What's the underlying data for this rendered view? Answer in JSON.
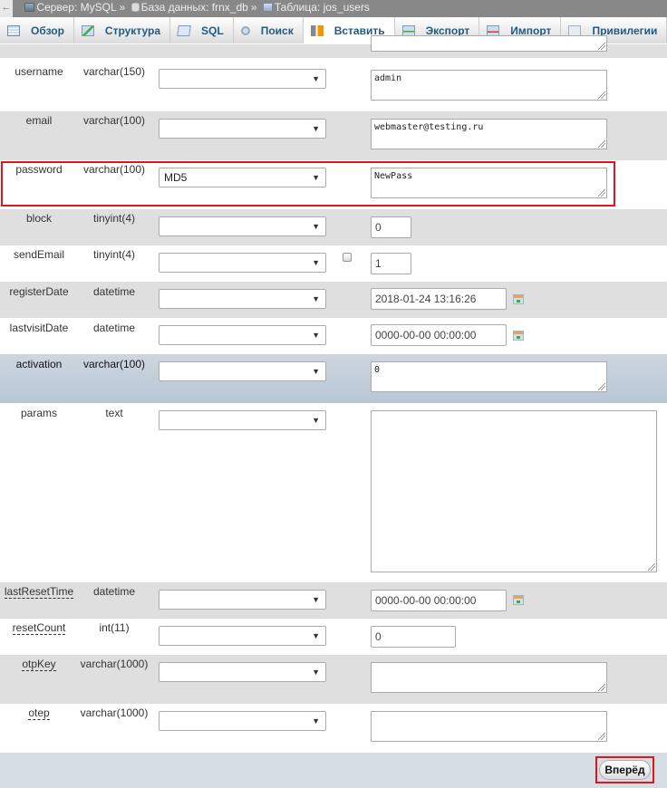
{
  "breadcrumb": {
    "back_icon": "arrow-left-icon",
    "items": [
      {
        "icon": "server-icon",
        "label": "Сервер: MySQL"
      },
      {
        "icon": "database-icon",
        "label": "База данных: frnx_db"
      },
      {
        "icon": "table-icon",
        "label": "Таблица: jos_users"
      }
    ],
    "separator": "»"
  },
  "tabs": [
    {
      "icon": "browse-icon",
      "label": "Обзор",
      "active": false
    },
    {
      "icon": "structure-icon",
      "label": "Структура",
      "active": false
    },
    {
      "icon": "sql-icon",
      "label": "SQL",
      "active": false
    },
    {
      "icon": "search-icon",
      "label": "Поиск",
      "active": false
    },
    {
      "icon": "insert-icon",
      "label": "Вставить",
      "active": true
    },
    {
      "icon": "export-icon",
      "label": "Экспорт",
      "active": false
    },
    {
      "icon": "import-icon",
      "label": "Импорт",
      "active": false
    },
    {
      "icon": "privileges-icon",
      "label": "Привилегии",
      "active": false
    }
  ],
  "fields": [
    {
      "name": "username",
      "type": "varchar(150)",
      "function": "",
      "value": "admin",
      "input": "textarea"
    },
    {
      "name": "email",
      "type": "varchar(100)",
      "function": "",
      "value": "webmaster@testing.ru",
      "input": "textarea"
    },
    {
      "name": "password",
      "type": "varchar(100)",
      "function": "MD5",
      "value": "NewPass",
      "input": "textarea",
      "highlighted": true
    },
    {
      "name": "block",
      "type": "tinyint(4)",
      "function": "",
      "value": "0",
      "input": "text"
    },
    {
      "name": "sendEmail",
      "type": "tinyint(4)",
      "function": "",
      "value": "1",
      "input": "text",
      "null_checkbox": false
    },
    {
      "name": "registerDate",
      "type": "datetime",
      "function": "",
      "value": "2018-01-24 13:16:26",
      "input": "datetime"
    },
    {
      "name": "lastvisitDate",
      "type": "datetime",
      "function": "",
      "value": "0000-00-00 00:00:00",
      "input": "datetime"
    },
    {
      "name": "activation",
      "type": "varchar(100)",
      "function": "",
      "value": "0",
      "input": "textarea"
    },
    {
      "name": "params",
      "type": "text",
      "function": "",
      "value": "",
      "input": "textarea"
    },
    {
      "name": "lastResetTime",
      "type": "datetime",
      "function": "",
      "value": "0000-00-00 00:00:00",
      "input": "datetime"
    },
    {
      "name": "resetCount",
      "type": "int(11)",
      "function": "",
      "value": "0",
      "input": "text"
    },
    {
      "name": "otpKey",
      "type": "varchar(1000)",
      "function": "",
      "value": "",
      "input": "textarea"
    },
    {
      "name": "otep",
      "type": "varchar(1000)",
      "function": "",
      "value": "",
      "input": "textarea"
    }
  ],
  "dropdown_arrow": "▼",
  "submit": {
    "label": "Вперёд"
  },
  "colors": {
    "highlight_border": "#e0161d",
    "tab_text": "#235a81",
    "row_alt": "#dfdfdf",
    "footer": "#d5dde5"
  }
}
